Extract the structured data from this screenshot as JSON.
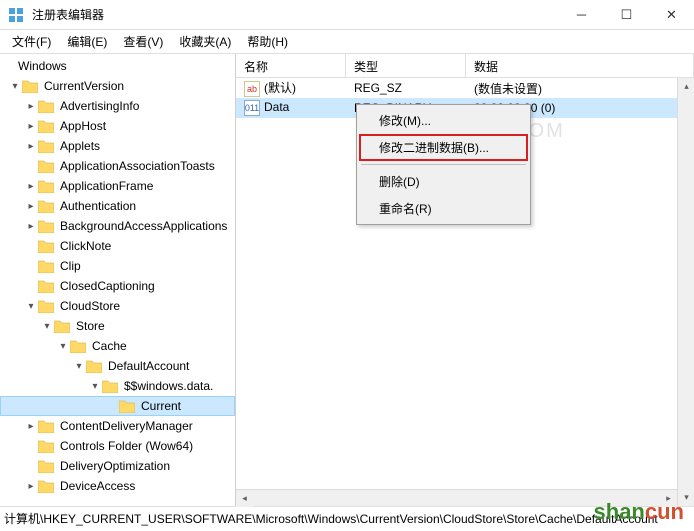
{
  "window": {
    "title": "注册表编辑器"
  },
  "menubar": {
    "file": "文件(F)",
    "edit": "编辑(E)",
    "view": "查看(V)",
    "favorites": "收藏夹(A)",
    "help": "帮助(H)"
  },
  "tree": {
    "root": "Windows",
    "n0": "CurrentVersion",
    "n1": "AdvertisingInfo",
    "n2": "AppHost",
    "n3": "Applets",
    "n4": "ApplicationAssociationToasts",
    "n5": "ApplicationFrame",
    "n6": "Authentication",
    "n7": "BackgroundAccessApplications",
    "n8": "ClickNote",
    "n9": "Clip",
    "n10": "ClosedCaptioning",
    "n11": "CloudStore",
    "n12": "Store",
    "n13": "Cache",
    "n14": "DefaultAccount",
    "n15": "$$windows.data.",
    "n16": "Current",
    "n17": "ContentDeliveryManager",
    "n18": "Controls Folder (Wow64)",
    "n19": "DeliveryOptimization",
    "n20": "DeviceAccess"
  },
  "list": {
    "col_name": "名称",
    "col_type": "类型",
    "col_data": "数据",
    "rows": [
      {
        "name": "(默认)",
        "type": "REG_SZ",
        "data": "(数值未设置)"
      },
      {
        "name": "Data",
        "type": "REG_BINARY",
        "data": "00 00 00 00 (0)"
      }
    ]
  },
  "context_menu": {
    "modify": "修改(M)...",
    "modify_binary": "修改二进制数据(B)...",
    "delete": "删除(D)",
    "rename": "重命名(R)"
  },
  "statusbar": {
    "path": "计算机\\HKEY_CURRENT_USER\\SOFTWARE\\Microsoft\\Windows\\CurrentVersion\\CloudStore\\Store\\Cache\\DefaultAccount"
  },
  "watermark": {
    "w1": "TAN.COM",
    "w2a": "shan",
    "w2b": "cun"
  }
}
